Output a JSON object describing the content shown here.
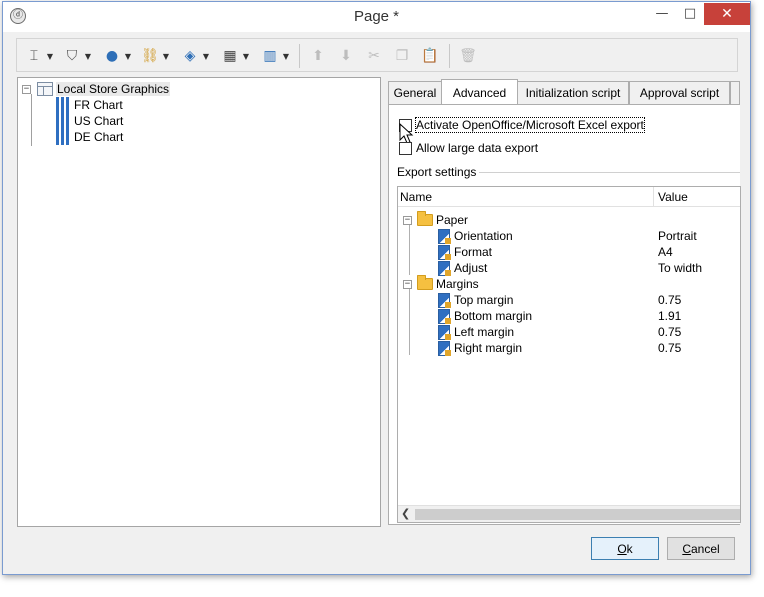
{
  "window": {
    "title": "Page *",
    "app_icon_glyph": "ⓓ",
    "minimize_glyph": "—",
    "maximize_glyph": "□",
    "close_glyph": "✕"
  },
  "toolbar": {
    "icons": {
      "insert": "⌶",
      "filter": "⛉",
      "web": "●",
      "link": "⛓",
      "layers": "◈",
      "table": "▦",
      "columns": "▥",
      "move_up": "⬆",
      "move_down": "⬇",
      "cut": "✂",
      "copy": "❐",
      "paste": "📋",
      "delete": "🗑"
    },
    "caret": "▼"
  },
  "tree": {
    "expander": "−",
    "root": "Local Store Graphics",
    "children": [
      "FR Chart",
      "US Chart",
      "DE Chart"
    ]
  },
  "tabs": [
    "General",
    "Advanced",
    "Initialization script",
    "Approval script"
  ],
  "advanced": {
    "activate_export_label": "Activate OpenOffice/Microsoft Excel export",
    "large_export_label": "Allow large data export",
    "export_settings_title": "Export settings",
    "columns": {
      "name": "Name",
      "value": "Value"
    },
    "groups": [
      {
        "name": "Paper",
        "items": [
          {
            "name": "Orientation",
            "value": "Portrait"
          },
          {
            "name": "Format",
            "value": "A4"
          },
          {
            "name": "Adjust",
            "value": "To width"
          }
        ]
      },
      {
        "name": "Margins",
        "items": [
          {
            "name": "Top margin",
            "value": "0.75"
          },
          {
            "name": "Bottom margin",
            "value": "1.91"
          },
          {
            "name": "Left margin",
            "value": "0.75"
          },
          {
            "name": "Right margin",
            "value": "0.75"
          }
        ]
      }
    ],
    "scroll_left": "❮"
  },
  "buttons": {
    "ok_mnemonic": "O",
    "ok_rest": "k",
    "cancel_mnemonic": "C",
    "cancel_rest": "ancel"
  }
}
